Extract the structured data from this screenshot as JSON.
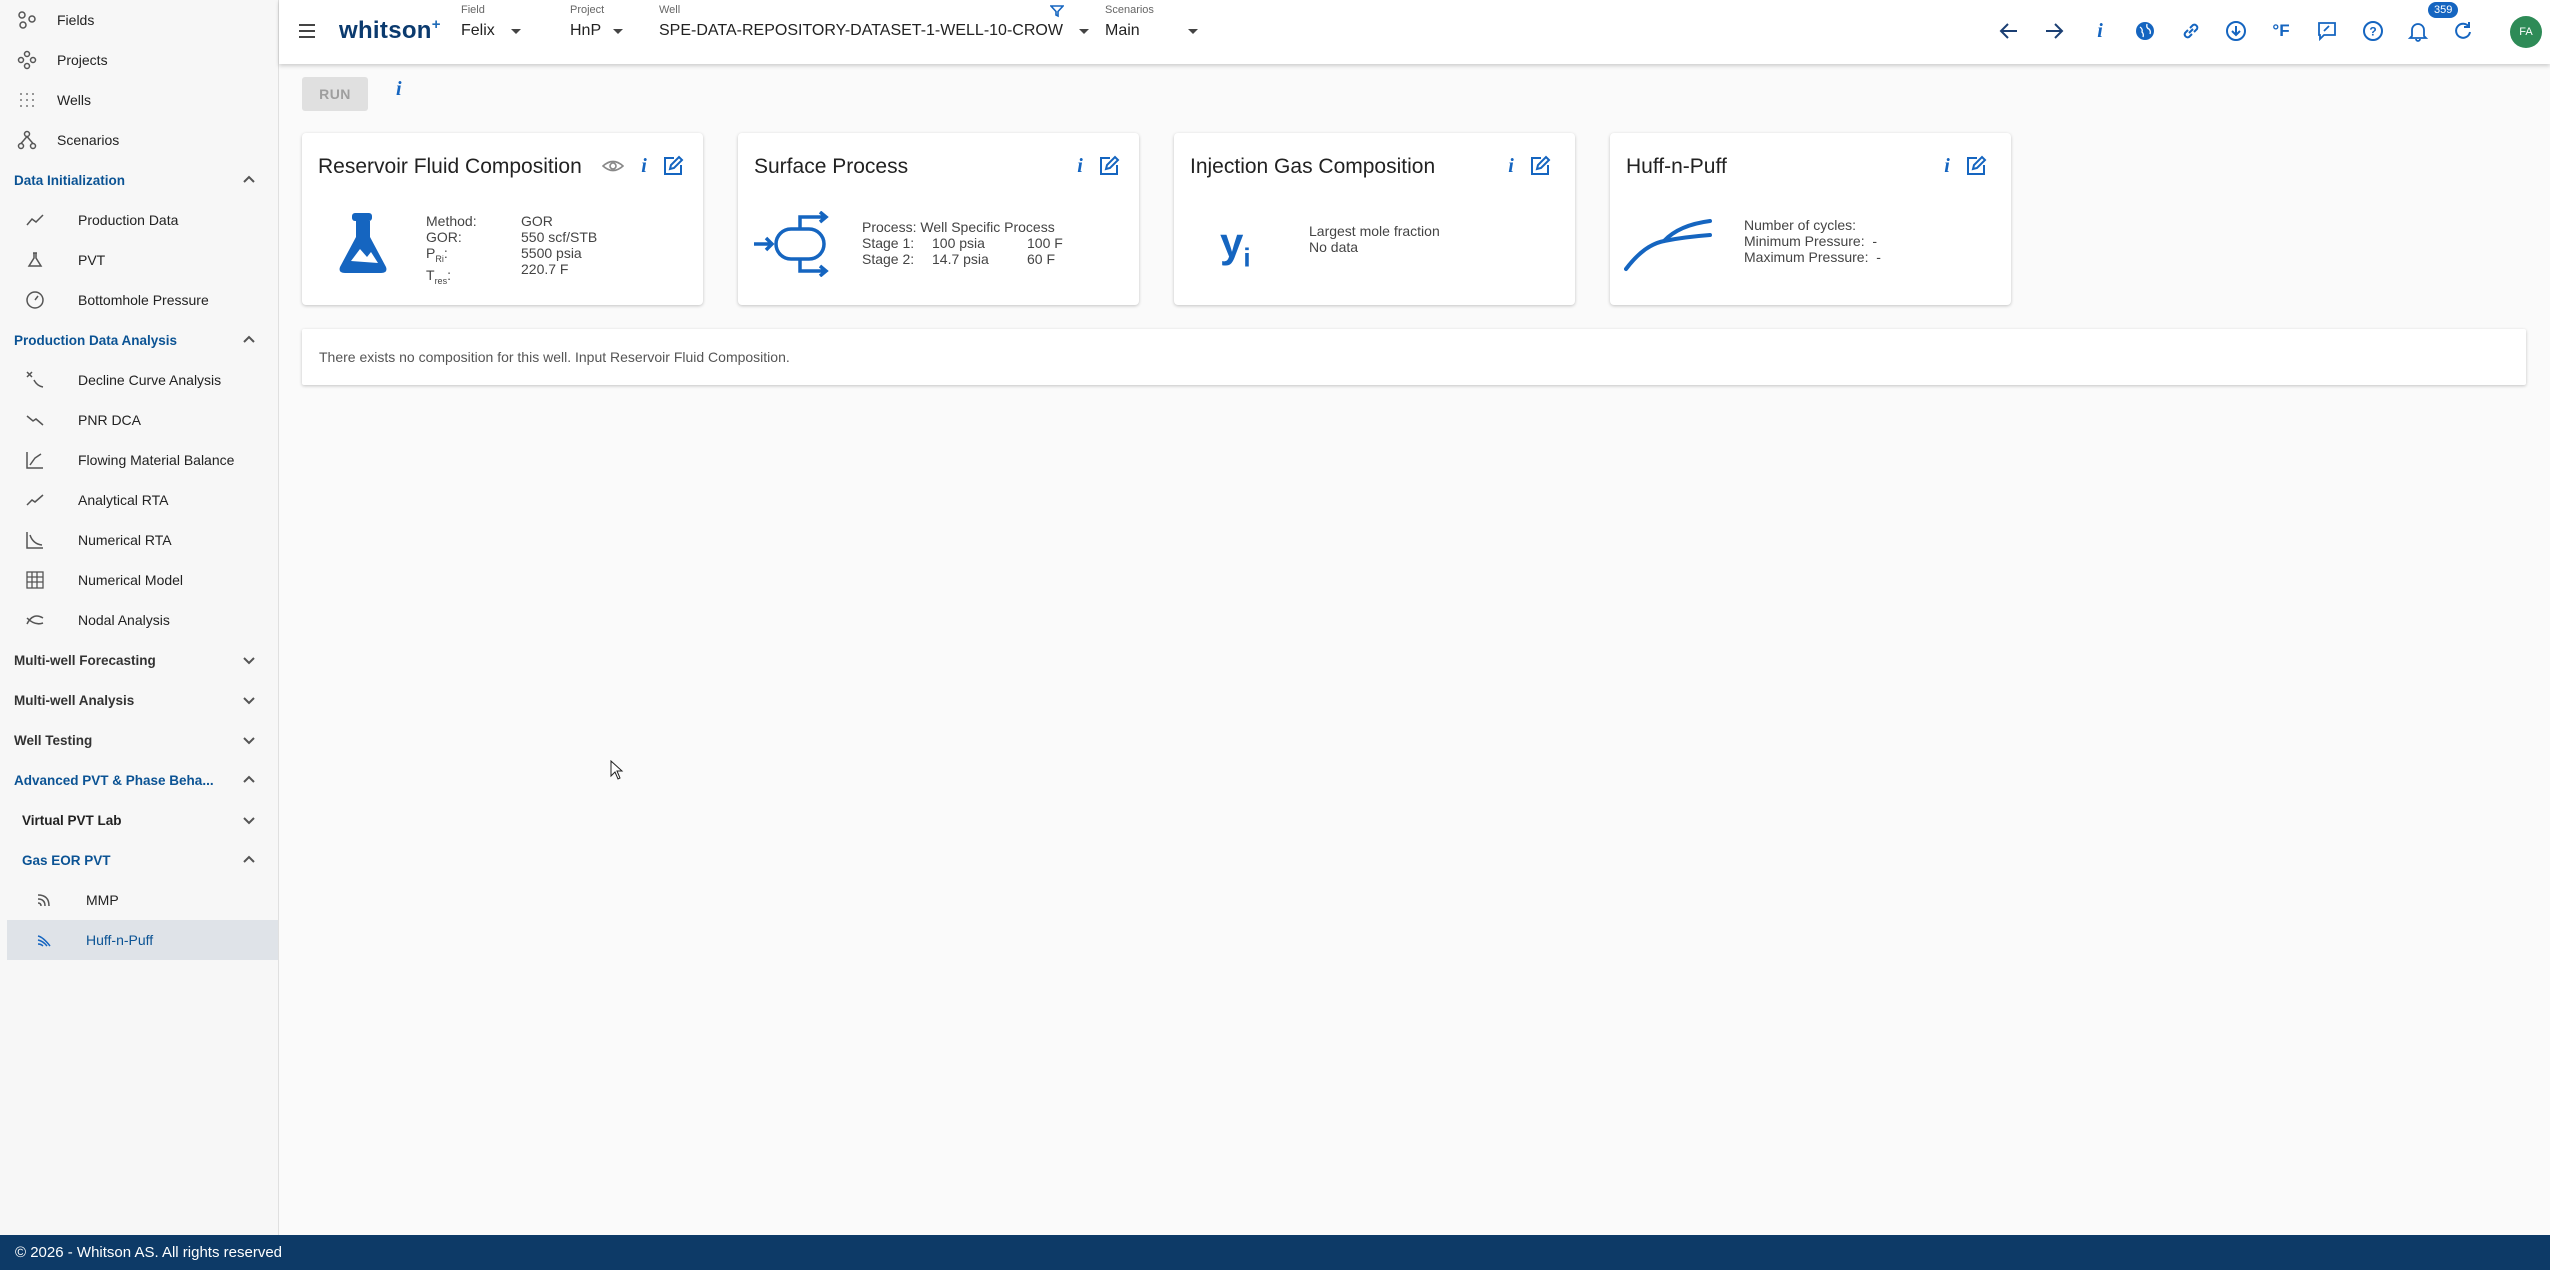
{
  "app": {
    "logo": "whitson",
    "logo_sup": "+"
  },
  "header": {
    "field": {
      "caption": "Field",
      "value": "Felix"
    },
    "project": {
      "caption": "Project",
      "value": "HnP"
    },
    "well": {
      "caption": "Well",
      "value": "SPE-DATA-REPOSITORY-DATASET-1-WELL-10-CROW"
    },
    "scenarios": {
      "caption": "Scenarios",
      "value": "Main"
    },
    "notifications_count": "359",
    "avatar_initials": "FA",
    "icons": [
      "arrow-left-icon",
      "arrow-right-icon",
      "info-icon",
      "globe-icon",
      "link-icon",
      "download-icon",
      "fahrenheit-icon",
      "chat-icon",
      "help-icon",
      "bell-icon",
      "refresh-icon"
    ]
  },
  "sidebar": {
    "top_items": [
      {
        "label": "Fields",
        "icon": "fields-icon"
      },
      {
        "label": "Projects",
        "icon": "projects-icon"
      },
      {
        "label": "Wells",
        "icon": "wells-icon"
      },
      {
        "label": "Scenarios",
        "icon": "scenarios-icon"
      }
    ],
    "data_initialization": {
      "title": "Data Initialization",
      "items": [
        "Production Data",
        "PVT",
        "Bottomhole Pressure"
      ]
    },
    "production_data_analysis": {
      "title": "Production Data Analysis",
      "items": [
        "Decline Curve Analysis",
        "PNR DCA",
        "Flowing Material Balance",
        "Analytical RTA",
        "Numerical RTA",
        "Numerical Model",
        "Nodal Analysis"
      ]
    },
    "collapsed_sections": [
      "Multi-well Forecasting",
      "Multi-well Analysis",
      "Well Testing"
    ],
    "advanced_pvt": {
      "title": "Advanced PVT & Phase Beha...",
      "virtual_pvt_lab": "Virtual PVT Lab",
      "gas_eor_pvt": "Gas EOR PVT",
      "items": [
        "MMP",
        "Huff-n-Puff"
      ]
    }
  },
  "toolbar": {
    "run_label": "RUN",
    "info_label": "i"
  },
  "cards": {
    "reservoir": {
      "title": "Reservoir Fluid Composition",
      "labels": [
        "Method:",
        "GOR:",
        "P",
        "T"
      ],
      "p_sub": "Ri",
      "t_sub": "res",
      "values": [
        "GOR",
        "550 scf/STB",
        "5500 psia",
        "220.7 F"
      ]
    },
    "surface": {
      "title": "Surface Process",
      "process": "Process: Well Specific Process",
      "stage1_label": "Stage 1:",
      "stage1_pressure": "100 psia",
      "stage1_temp": "100 F",
      "stage2_label": "Stage 2:",
      "stage2_pressure": "14.7 psia",
      "stage2_temp": "60 F"
    },
    "injection": {
      "title": "Injection Gas Composition",
      "symbol": "y",
      "symbol_sub": "i",
      "line1": "Largest mole fraction",
      "line2": "No data"
    },
    "huff": {
      "title": "Huff-n-Puff",
      "line1": "Number of cycles:",
      "line2": "Minimum Pressure:",
      "line2_val": "-",
      "line3": "Maximum Pressure:",
      "line3_val": "-"
    }
  },
  "message": "There exists no composition for this well. Input Reservoir Fluid Composition.",
  "footer": "© 2026 - Whitson AS. All rights reserved",
  "colors": {
    "accent": "#1565c0",
    "navy": "#0d3a67",
    "section_blue": "#0b5394",
    "avatar": "#2e8b57"
  }
}
